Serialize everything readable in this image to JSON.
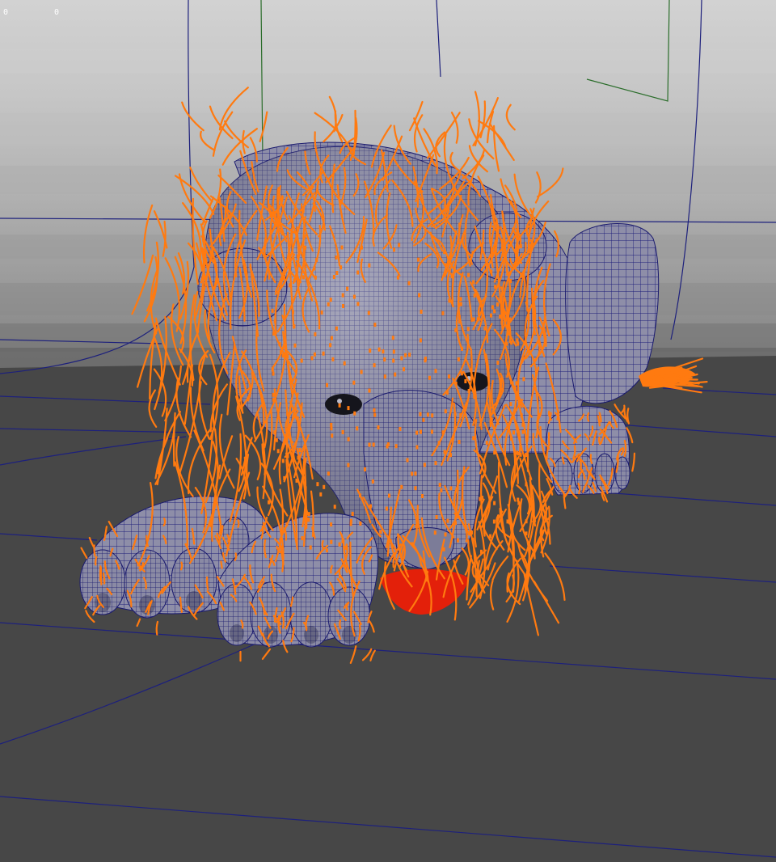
{
  "viewport": {
    "hud": {
      "left_readout": "0",
      "right_readout": "0"
    },
    "model": {
      "subject": "lion",
      "display_mode": "wireframe-on-shaded",
      "hair_guides_visible": true
    },
    "colors": {
      "backdrop_gradient": [
        "#d0d0d0",
        "#c2c2c2",
        "#b3b3b3",
        "#9f9f9f",
        "#8a8a8a",
        "#6f6f6f"
      ],
      "floor": "#484848",
      "grid_lines": "#1c1f7a",
      "axis_green": "#2a6d2a",
      "mesh_fill": "#8c8ca8",
      "mesh_wire": "#1a1a6e",
      "hair_guides": "#ff7a10",
      "selection_red": "#ff1a00",
      "eyes": "#15151c"
    }
  }
}
